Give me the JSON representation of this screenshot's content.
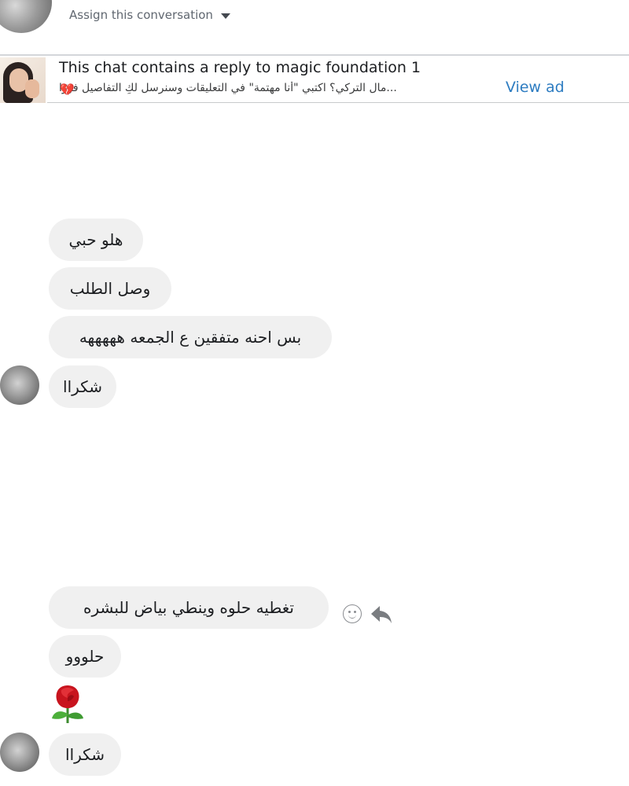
{
  "header": {
    "assign_label": "Assign this conversation",
    "caret_icon": "chevron-down-icon"
  },
  "ad_reply": {
    "title": "This chat contains a reply to magic foundation 1",
    "preview": "...مال التركي؟ اكتبي \"أنا مهتمة\" في التعليقات وسنرسل لكِ التفاصيل فورًا",
    "heart_icon": "broken-heart-icon",
    "view_ad_label": "View ad"
  },
  "messages": [
    {
      "text": "هلو حبي"
    },
    {
      "text": "وصل الطلب"
    },
    {
      "text": "بس احنه متفقين ع الجمعه هههههه"
    },
    {
      "text": "شكراا"
    },
    {
      "text": "تغطيه حلوه وينطي بياض للبشره"
    },
    {
      "text": "حلووو"
    },
    {
      "emoji": "rose-emoji-icon"
    },
    {
      "text": "شكراا"
    }
  ],
  "message_actions": {
    "react_icon": "smiley-react-icon",
    "reply_icon": "reply-arrow-icon"
  },
  "colors": {
    "bubble_bg": "#f0f0f0",
    "link_blue": "#2d7cc1",
    "divider": "#d4d6da"
  }
}
